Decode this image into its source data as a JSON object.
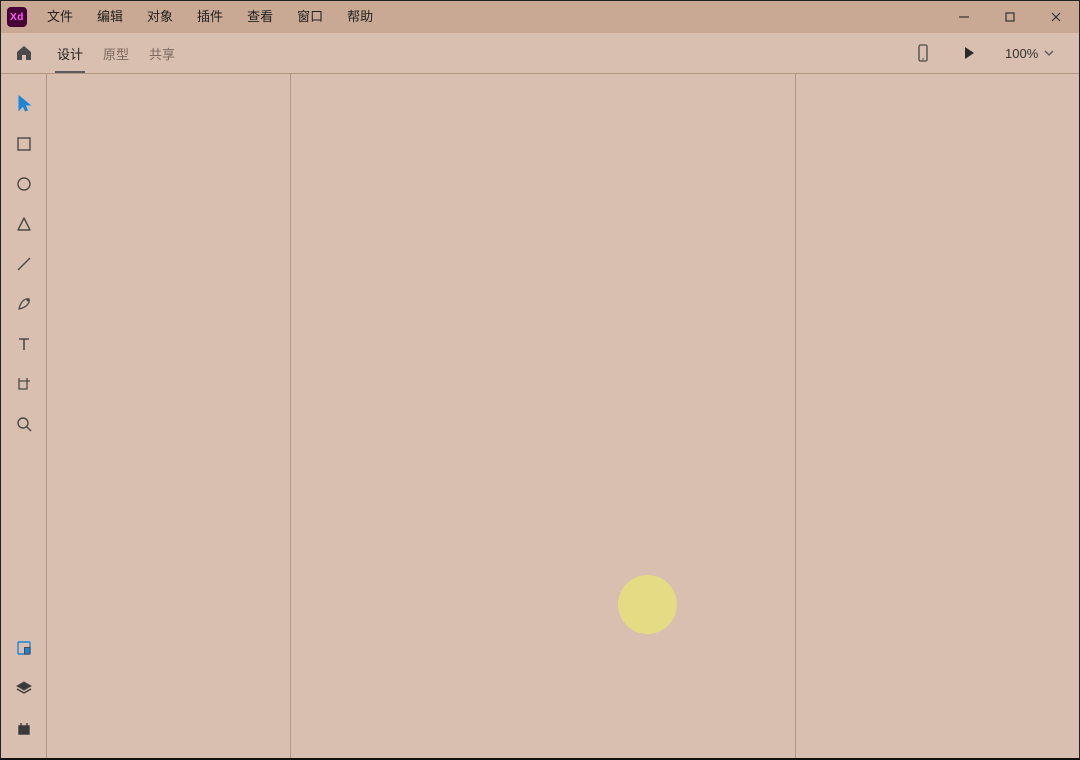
{
  "app": {
    "logo_text": "Xd"
  },
  "menubar": {
    "items": [
      "文件",
      "编辑",
      "对象",
      "插件",
      "查看",
      "窗口",
      "帮助"
    ]
  },
  "tabs": {
    "design": "设计",
    "prototype": "原型",
    "share": "共享",
    "active": "design"
  },
  "zoom": {
    "value": "100%"
  },
  "tools": {
    "select": "select-tool",
    "rectangle": "rectangle-tool",
    "ellipse": "ellipse-tool",
    "polygon": "polygon-tool",
    "line": "line-tool",
    "pen": "pen-tool",
    "text": "text-tool",
    "artboard": "artboard-tool",
    "zoom": "zoom-tool"
  },
  "panels": {
    "libraries": "libraries-panel",
    "layers": "layers-panel",
    "plugins": "plugins-panel"
  }
}
